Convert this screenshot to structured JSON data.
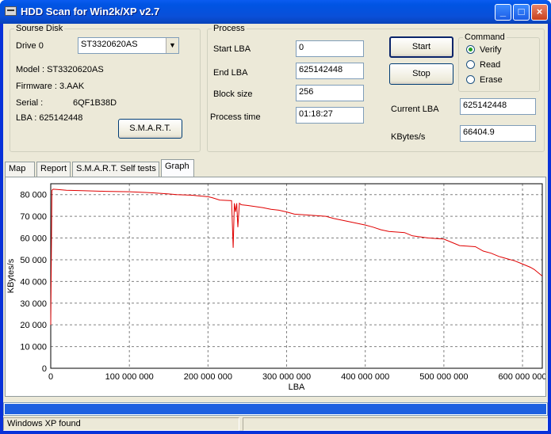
{
  "window": {
    "title": "HDD Scan for Win2k/XP  v2.7"
  },
  "source_disk": {
    "legend": "Sourse Disk",
    "drive_label": "Drive  0",
    "drive_value": "ST3320620AS",
    "model": "Model : ST3320620AS",
    "firmware": "Firmware : 3.AAK",
    "serial_label": "Serial :",
    "serial_value": "6QF1B38D",
    "lba": "LBA :   625142448",
    "smart_button": "S.M.A.R.T."
  },
  "process": {
    "legend": "Process",
    "start_lba_label": "Start LBA",
    "start_lba_value": "0",
    "end_lba_label": "End LBA",
    "end_lba_value": "625142448",
    "block_size_label": "Block size",
    "block_size_value": "256",
    "process_time_label": "Process time",
    "process_time_value": "01:18:27",
    "start_button": "Start",
    "stop_button": "Stop",
    "current_lba_label": "Current LBA",
    "current_lba_value": "625142448",
    "kbytes_label": "KBytes/s",
    "kbytes_value": "66404.9"
  },
  "command": {
    "legend": "Command",
    "options": [
      {
        "label": "Verify",
        "selected": true
      },
      {
        "label": "Read",
        "selected": false
      },
      {
        "label": "Erase",
        "selected": false
      }
    ]
  },
  "tabs": [
    {
      "label": "Map",
      "active": false
    },
    {
      "label": "Report",
      "active": false
    },
    {
      "label": "S.M.A.R.T. Self tests",
      "active": false
    },
    {
      "label": "Graph",
      "active": true
    }
  ],
  "progress": {
    "fraction": 1.0,
    "color": "#1e60e0"
  },
  "status_bar": {
    "text": "Windows XP found"
  },
  "chart_data": {
    "type": "line",
    "xlabel": "LBA",
    "ylabel": "KBytes/s",
    "xlim": [
      0,
      625142448
    ],
    "ylim": [
      0,
      85000
    ],
    "xticks": [
      0,
      100000000,
      200000000,
      300000000,
      400000000,
      500000000,
      600000000
    ],
    "xtick_labels": [
      "0",
      "100 000 000",
      "200 000 000",
      "300 000 000",
      "400 000 000",
      "500 000 000",
      "600 000 000"
    ],
    "yticks": [
      0,
      10000,
      20000,
      30000,
      40000,
      50000,
      60000,
      70000,
      80000
    ],
    "ytick_labels": [
      "0",
      "10 000",
      "20 000",
      "30 000",
      "40 000",
      "50 000",
      "60 000",
      "70 000",
      "80 000"
    ],
    "grid": true,
    "line_color": "#e00000",
    "series": [
      {
        "x": [
          0,
          1500000,
          3000000,
          10000000,
          20000000,
          40000000,
          70000000,
          100000000,
          120000000,
          130000000,
          150000000,
          160000000,
          180000000,
          200000000,
          205000000,
          215000000,
          230000000,
          232000000,
          233500000,
          235000000,
          236500000,
          238000000,
          240000000,
          241500000,
          243000000,
          250000000,
          270000000,
          280000000,
          290000000,
          300000000,
          310000000,
          330000000,
          350000000,
          360000000,
          380000000,
          400000000,
          410000000,
          420000000,
          430000000,
          450000000,
          460000000,
          480000000,
          500000000,
          510000000,
          520000000,
          540000000,
          550000000,
          560000000,
          570000000,
          580000000,
          590000000,
          600000000,
          610000000,
          615000000,
          625000000
        ],
        "y": [
          20000,
          82000,
          82500,
          82300,
          82000,
          81800,
          81500,
          81300,
          81000,
          80800,
          80300,
          80000,
          79700,
          79000,
          78600,
          77500,
          77200,
          55500,
          76000,
          72000,
          76000,
          65000,
          76000,
          75500,
          75300,
          75000,
          74000,
          73200,
          72800,
          72000,
          71000,
          70500,
          70000,
          69000,
          67500,
          66000,
          65000,
          63800,
          63000,
          62500,
          61000,
          60000,
          59500,
          58000,
          56500,
          56000,
          54000,
          53000,
          51500,
          50500,
          49500,
          48000,
          46500,
          45500,
          42500
        ]
      }
    ]
  }
}
